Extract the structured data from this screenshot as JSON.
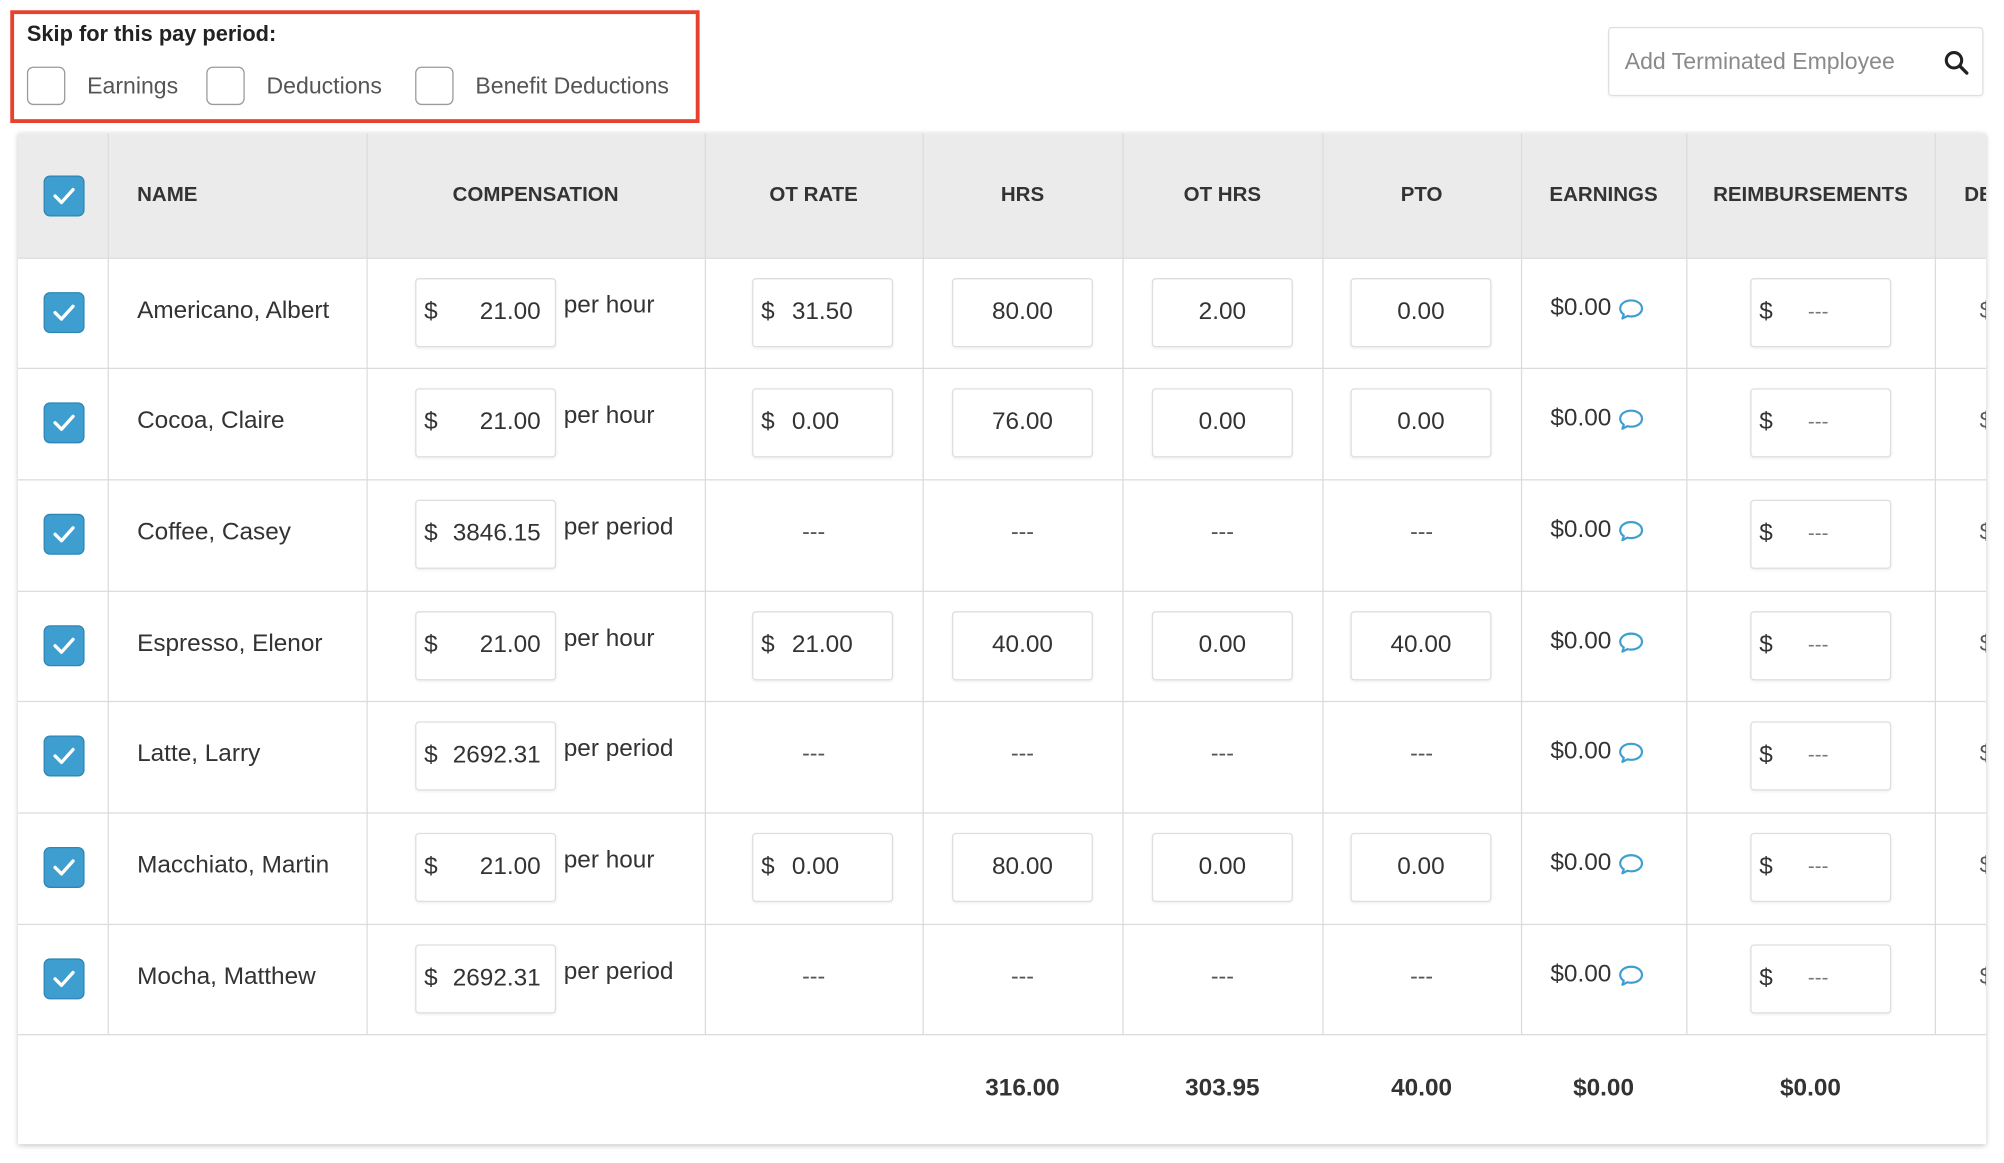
{
  "skip": {
    "title": "Skip for this pay period:",
    "options": [
      {
        "label": "Earnings",
        "checked": false
      },
      {
        "label": "Deductions",
        "checked": false
      },
      {
        "label": "Benefit Deductions",
        "checked": false
      }
    ]
  },
  "search": {
    "placeholder": "Add Terminated Employee",
    "icon": "search-icon"
  },
  "table": {
    "headers": {
      "name": "NAME",
      "compensation": "COMPENSATION",
      "ot_rate": "OT RATE",
      "hrs": "HRS",
      "ot_hrs": "OT HRS",
      "pto": "PTO",
      "earnings": "EARNINGS",
      "reimbursements": "REIMBURSEMENTS",
      "next_partial": "DE"
    },
    "currency": "$",
    "empty": "---",
    "rows": [
      {
        "name": "Americano, Albert",
        "comp": "21.00",
        "unit": "per hour",
        "ot_rate": "31.50",
        "hrs": "80.00",
        "ot_hrs": "2.00",
        "pto": "0.00",
        "earnings": "$0.00",
        "reimb": "---"
      },
      {
        "name": "Cocoa, Claire",
        "comp": "21.00",
        "unit": "per hour",
        "ot_rate": "0.00",
        "hrs": "76.00",
        "ot_hrs": "0.00",
        "pto": "0.00",
        "earnings": "$0.00",
        "reimb": "---"
      },
      {
        "name": "Coffee, Casey",
        "comp": "3846.15",
        "unit": "per period",
        "ot_rate": null,
        "hrs": null,
        "ot_hrs": null,
        "pto": null,
        "earnings": "$0.00",
        "reimb": "---"
      },
      {
        "name": "Espresso, Elenor",
        "comp": "21.00",
        "unit": "per hour",
        "ot_rate": "21.00",
        "hrs": "40.00",
        "ot_hrs": "0.00",
        "pto": "40.00",
        "earnings": "$0.00",
        "reimb": "---"
      },
      {
        "name": "Latte, Larry",
        "comp": "2692.31",
        "unit": "per period",
        "ot_rate": null,
        "hrs": null,
        "ot_hrs": null,
        "pto": null,
        "earnings": "$0.00",
        "reimb": "---"
      },
      {
        "name": "Macchiato, Martin",
        "comp": "21.00",
        "unit": "per hour",
        "ot_rate": "0.00",
        "hrs": "80.00",
        "ot_hrs": "0.00",
        "pto": "0.00",
        "earnings": "$0.00",
        "reimb": "---"
      },
      {
        "name": "Mocha, Matthew",
        "comp": "2692.31",
        "unit": "per period",
        "ot_rate": null,
        "hrs": null,
        "ot_hrs": null,
        "pto": null,
        "earnings": "$0.00",
        "reimb": "---"
      }
    ],
    "totals": {
      "hrs": "316.00",
      "ot_hrs": "303.95",
      "pto": "40.00",
      "earnings": "$0.00",
      "reimbursements": "$0.00"
    }
  },
  "colors": {
    "accent": "#3e9ed0",
    "highlight_border": "#e8422f",
    "comment_icon": "#3e9ed0"
  }
}
